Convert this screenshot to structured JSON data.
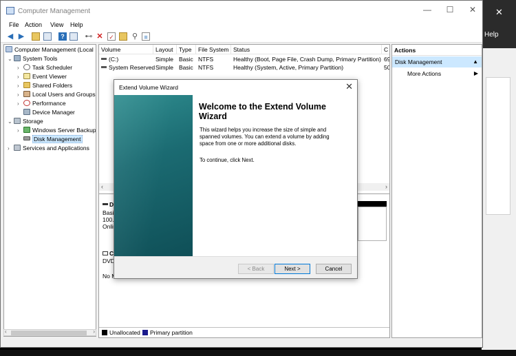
{
  "window": {
    "title": "Computer Management",
    "minimize": "—",
    "maximize": "☐",
    "close": "✕"
  },
  "background_window": {
    "close": "✕",
    "menu_label": "Help"
  },
  "menu": [
    "File",
    "Action",
    "View",
    "Help"
  ],
  "toolbar_icons": [
    "back-icon",
    "forward-icon",
    "up-folder-icon",
    "show-hide-tree-icon",
    "help-icon",
    "properties-icon",
    "connect-icon",
    "delete-icon",
    "check-icon",
    "folder-icon",
    "search-icon",
    "refresh-icon"
  ],
  "tree": {
    "root": "Computer Management (Local",
    "system_tools": "System Tools",
    "task_scheduler": "Task Scheduler",
    "event_viewer": "Event Viewer",
    "shared_folders": "Shared Folders",
    "local_users": "Local Users and Groups",
    "performance": "Performance",
    "device_manager": "Device Manager",
    "storage": "Storage",
    "windows_server_backup": "Windows Server Backup",
    "disk_management": "Disk Management",
    "services": "Services and Applications"
  },
  "volume_list": {
    "columns": [
      "Volume",
      "Layout",
      "Type",
      "File System",
      "Status",
      "C"
    ],
    "rows": [
      {
        "volume": "(C:)",
        "layout": "Simple",
        "type": "Basic",
        "fs": "NTFS",
        "status": "Healthy (Boot, Page File, Crash Dump, Primary Partition)",
        "cap": "69"
      },
      {
        "volume": "System Reserved",
        "layout": "Simple",
        "type": "Basic",
        "fs": "NTFS",
        "status": "Healthy (System, Active, Primary Partition)",
        "cap": "50"
      }
    ]
  },
  "disks": {
    "disk0_name": "D",
    "disk0_type": "Basic",
    "disk0_size": "100.0",
    "disk0_state": "Onlin",
    "cd_name": "C",
    "cd_type": "DVD",
    "cd_media": "No M"
  },
  "legend": {
    "unallocated": "Unallocated",
    "primary": "Primary partition",
    "unallocated_color": "#000000",
    "primary_color": "#1a1a8c"
  },
  "actions": {
    "title": "Actions",
    "selected": "Disk Management",
    "more": "More Actions"
  },
  "wizard": {
    "title": "Extend Volume Wizard",
    "heading": "Welcome to the Extend Volume Wizard",
    "body": "This wizard helps you increase the size of simple and spanned volumes. You can extend a volume  by adding space from one or more additional disks.",
    "continue": "To continue, click Next.",
    "back": "< Back",
    "next": "Next >",
    "cancel": "Cancel"
  }
}
